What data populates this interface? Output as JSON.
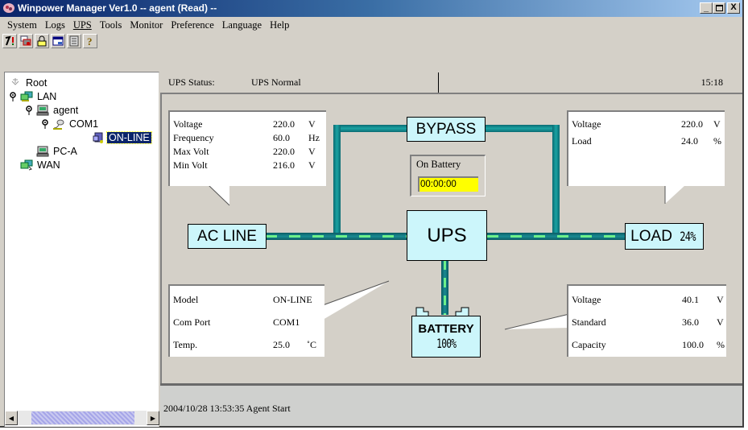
{
  "window": {
    "title": "Winpower Manager Ver1.0 -- agent (Read) --",
    "controls": {
      "minimize": "_",
      "maximize": "□",
      "close": "X"
    }
  },
  "menu": [
    {
      "label": "System",
      "icon": null
    },
    {
      "label": "Logs"
    },
    {
      "label": "UPS"
    },
    {
      "label": "Tools"
    },
    {
      "label": "Monitor"
    },
    {
      "label": "Preference"
    },
    {
      "label": "Language"
    },
    {
      "label": "Help"
    }
  ],
  "toolbar": [
    {
      "icon": "tools-icon"
    },
    {
      "icon": "schedule-icon"
    },
    {
      "icon": "lock-icon"
    },
    {
      "icon": "window-icon"
    },
    {
      "icon": "log-icon"
    },
    {
      "icon": "help-icon"
    }
  ],
  "tree": {
    "root": "Root",
    "lan": "LAN",
    "agent": "agent",
    "com1": "COM1",
    "online": "ON-LINE",
    "pca": "PC-A",
    "wan": "WAN"
  },
  "status": {
    "label": "UPS Status:",
    "value": "UPS Normal",
    "time": "15:18"
  },
  "input_panel": {
    "rows": [
      {
        "key": "Voltage",
        "value": "220.0",
        "unit": "V"
      },
      {
        "key": "Frequency",
        "value": "60.0",
        "unit": "Hz"
      },
      {
        "key": "Max Volt",
        "value": "220.0",
        "unit": "V"
      },
      {
        "key": "Min Volt",
        "value": "216.0",
        "unit": "V"
      }
    ]
  },
  "output_panel": {
    "rows": [
      {
        "key": "Voltage",
        "value": "220.0",
        "unit": "V"
      },
      {
        "key": "Load",
        "value": "24.0",
        "unit": "%"
      }
    ]
  },
  "ups_panel": {
    "rows": [
      {
        "key": "Model",
        "value": "ON-LINE",
        "unit": ""
      },
      {
        "key": "Com Port",
        "value": "COM1",
        "unit": ""
      },
      {
        "key": "Temp.",
        "value": "25.0",
        "unit": "˚C"
      }
    ]
  },
  "battery_panel": {
    "rows": [
      {
        "key": "Voltage",
        "value": "40.1",
        "unit": "V"
      },
      {
        "key": "Standard",
        "value": "36.0",
        "unit": "V"
      },
      {
        "key": "Capacity",
        "value": "100.0",
        "unit": "%"
      }
    ]
  },
  "diagram": {
    "bypass": "BYPASS",
    "ac_line": "AC LINE",
    "ups": "UPS",
    "load": "LOAD",
    "load_percent": "24%",
    "battery": "BATTERY",
    "battery_percent": "100%",
    "on_battery_label": "On Battery",
    "on_battery_timer": "00:00:00"
  },
  "log": {
    "entry": "2004/10/28 13:53:35  Agent Start"
  },
  "colors": {
    "titlebar": "#0a246a",
    "box_fill": "#ccf6fb",
    "pipe": "#1aa3a3",
    "flow": "#6df08a",
    "timer_bg": "#ffff00",
    "selection": "#0a246a"
  }
}
